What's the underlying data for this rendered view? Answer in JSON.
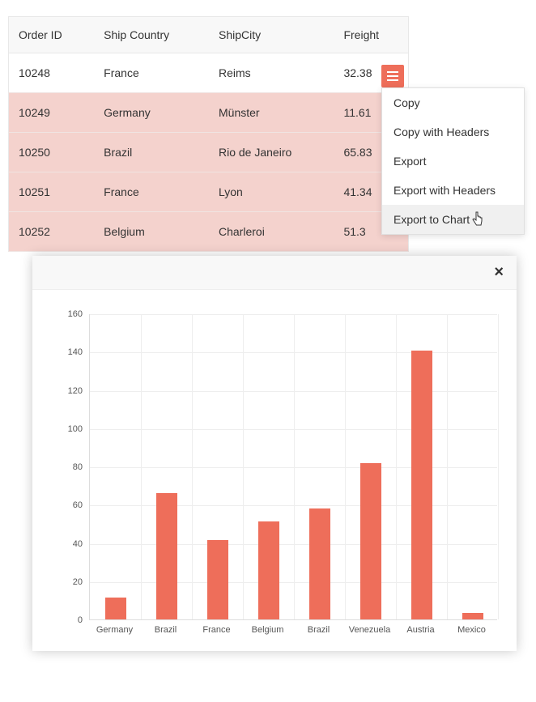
{
  "table": {
    "columns": [
      "Order ID",
      "Ship Country",
      "ShipCity",
      "Freight"
    ],
    "rows": [
      {
        "id": "10248",
        "country": "France",
        "city": "Reims",
        "freight": "32.38",
        "selected": false
      },
      {
        "id": "10249",
        "country": "Germany",
        "city": "Münster",
        "freight": "11.61",
        "selected": true
      },
      {
        "id": "10250",
        "country": "Brazil",
        "city": "Rio de Janeiro",
        "freight": "65.83",
        "selected": true
      },
      {
        "id": "10251",
        "country": "France",
        "city": "Lyon",
        "freight": "41.34",
        "selected": true
      },
      {
        "id": "10252",
        "country": "Belgium",
        "city": "Charleroi",
        "freight": "51.3",
        "selected": true
      }
    ]
  },
  "context_menu": {
    "items": [
      {
        "label": "Copy",
        "highlighted": false
      },
      {
        "label": "Copy with Headers",
        "highlighted": false
      },
      {
        "label": "Export",
        "highlighted": false
      },
      {
        "label": "Export with Headers",
        "highlighted": false
      },
      {
        "label": "Export to Chart",
        "highlighted": true
      }
    ]
  },
  "chart_modal": {
    "close_label": "×"
  },
  "chart_data": {
    "type": "bar",
    "categories": [
      "Germany",
      "Brazil",
      "France",
      "Belgium",
      "Brazil",
      "Venezuela",
      "Austria",
      "Mexico"
    ],
    "values": [
      11.61,
      65.83,
      41.34,
      51.3,
      58.17,
      81.91,
      140.51,
      3.25
    ],
    "ylim": [
      0,
      160
    ],
    "ystep": 20,
    "title": "",
    "xlabel": "",
    "ylabel": ""
  },
  "colors": {
    "accent": "#ee6e5a",
    "selected_row": "#f4d2cd"
  }
}
